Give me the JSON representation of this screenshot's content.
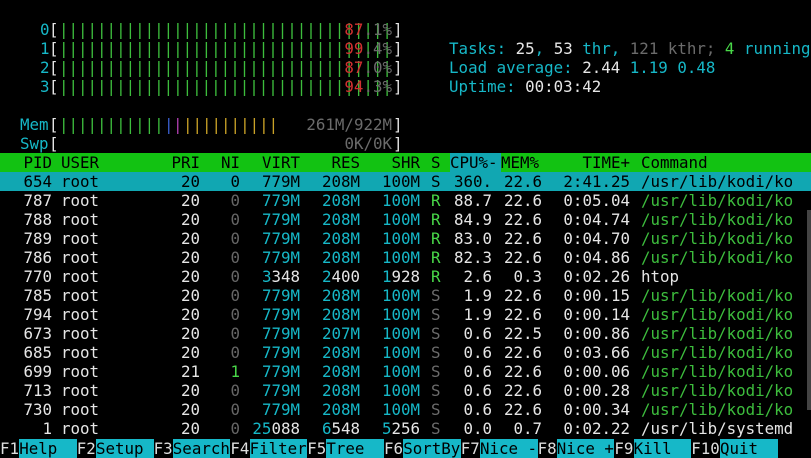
{
  "cpus": [
    {
      "label": "0",
      "bar": "|||||||||||||||||||||||||||||||||||",
      "percent": "87.1%"
    },
    {
      "label": "1",
      "bar": "|||||||||||||||||||||||||||||||||||",
      "percent": "99.4%"
    },
    {
      "label": "2",
      "bar": "|||||||||||||||||||||||||||||||||||",
      "percent": "87.0%"
    },
    {
      "label": "3",
      "bar": "|||||||||||||||||||||||||||||||||||",
      "percent": "94.3%"
    }
  ],
  "mem": {
    "label": "Mem",
    "bar_green": "|||||||||||",
    "bar_blue": "|",
    "bar_magenta": "|",
    "bar_yellow": "||||||||||",
    "value": "261M/922M"
  },
  "swp": {
    "label": "Swp",
    "value": "0K/0K"
  },
  "summary": {
    "tasks_label": "Tasks: ",
    "tasks": "25",
    "threads": "53",
    "thr_label": " thr, ",
    "kthr": "121",
    "kthr_label": " kthr; ",
    "running": "4",
    "running_label": " running",
    "load_label": "Load average: ",
    "load1": "2.44",
    "load5": "1.19",
    "load15": "0.48",
    "uptime_label": "Uptime: ",
    "uptime": "00:03:42"
  },
  "columns": [
    "PID",
    "USER",
    "PRI",
    "NI",
    "VIRT",
    "RES",
    "SHR",
    "S",
    "CPU%",
    "MEM%",
    "TIME+",
    "Command"
  ],
  "columns_display": {
    "pid": "PID",
    "user": "USER",
    "pri": "PRI",
    "ni": "NI",
    "virt": "VIRT",
    "res": "RES",
    "shr": "SHR",
    "s": "S",
    "cpu": "CPU%-",
    "mem": "MEM%",
    "time": "TIME+",
    "cmd": "Command"
  },
  "processes": [
    {
      "pid": "654",
      "user": "root",
      "pri": "20",
      "ni": "0",
      "virt": "779M",
      "res": "208M",
      "shr": "100M",
      "s": "S",
      "cpu": "360.",
      "mem": "22.6",
      "time": "2:41.25",
      "cmd": "/usr/lib/kodi/ko"
    },
    {
      "pid": "787",
      "user": "root",
      "pri": "20",
      "ni": "0",
      "virt": "779M",
      "res": "208M",
      "shr": "100M",
      "s": "R",
      "cpu": "88.7",
      "mem": "22.6",
      "time": "0:05.04",
      "cmd": "/usr/lib/kodi/ko"
    },
    {
      "pid": "788",
      "user": "root",
      "pri": "20",
      "ni": "0",
      "virt": "779M",
      "res": "208M",
      "shr": "100M",
      "s": "R",
      "cpu": "84.9",
      "mem": "22.6",
      "time": "0:04.74",
      "cmd": "/usr/lib/kodi/ko"
    },
    {
      "pid": "789",
      "user": "root",
      "pri": "20",
      "ni": "0",
      "virt": "779M",
      "res": "208M",
      "shr": "100M",
      "s": "R",
      "cpu": "83.0",
      "mem": "22.6",
      "time": "0:04.70",
      "cmd": "/usr/lib/kodi/ko"
    },
    {
      "pid": "786",
      "user": "root",
      "pri": "20",
      "ni": "0",
      "virt": "779M",
      "res": "208M",
      "shr": "100M",
      "s": "R",
      "cpu": "82.3",
      "mem": "22.6",
      "time": "0:04.86",
      "cmd": "/usr/lib/kodi/ko"
    },
    {
      "pid": "770",
      "user": "root",
      "pri": "20",
      "ni": "0",
      "virt": "3348",
      "res": "2400",
      "shr": "1928",
      "s": "R",
      "cpu": "2.6",
      "mem": "0.3",
      "time": "0:02.26",
      "cmd": "htop"
    },
    {
      "pid": "785",
      "user": "root",
      "pri": "20",
      "ni": "0",
      "virt": "779M",
      "res": "208M",
      "shr": "100M",
      "s": "S",
      "cpu": "1.9",
      "mem": "22.6",
      "time": "0:00.15",
      "cmd": "/usr/lib/kodi/ko"
    },
    {
      "pid": "794",
      "user": "root",
      "pri": "20",
      "ni": "0",
      "virt": "779M",
      "res": "208M",
      "shr": "100M",
      "s": "S",
      "cpu": "1.9",
      "mem": "22.6",
      "time": "0:00.14",
      "cmd": "/usr/lib/kodi/ko"
    },
    {
      "pid": "673",
      "user": "root",
      "pri": "20",
      "ni": "0",
      "virt": "779M",
      "res": "207M",
      "shr": "100M",
      "s": "S",
      "cpu": "0.6",
      "mem": "22.5",
      "time": "0:00.86",
      "cmd": "/usr/lib/kodi/ko"
    },
    {
      "pid": "685",
      "user": "root",
      "pri": "20",
      "ni": "0",
      "virt": "779M",
      "res": "208M",
      "shr": "100M",
      "s": "S",
      "cpu": "0.6",
      "mem": "22.6",
      "time": "0:03.66",
      "cmd": "/usr/lib/kodi/ko"
    },
    {
      "pid": "699",
      "user": "root",
      "pri": "21",
      "ni": "1",
      "virt": "779M",
      "res": "208M",
      "shr": "100M",
      "s": "S",
      "cpu": "0.6",
      "mem": "22.6",
      "time": "0:00.06",
      "cmd": "/usr/lib/kodi/ko"
    },
    {
      "pid": "713",
      "user": "root",
      "pri": "20",
      "ni": "0",
      "virt": "779M",
      "res": "208M",
      "shr": "100M",
      "s": "S",
      "cpu": "0.6",
      "mem": "22.6",
      "time": "0:00.28",
      "cmd": "/usr/lib/kodi/ko"
    },
    {
      "pid": "730",
      "user": "root",
      "pri": "20",
      "ni": "0",
      "virt": "779M",
      "res": "208M",
      "shr": "100M",
      "s": "S",
      "cpu": "0.6",
      "mem": "22.6",
      "time": "0:00.34",
      "cmd": "/usr/lib/kodi/ko"
    },
    {
      "pid": "1",
      "user": "root",
      "pri": "20",
      "ni": "0",
      "virt": "25088",
      "res": "6548",
      "shr": "5256",
      "s": "S",
      "cpu": "0.0",
      "mem": "0.7",
      "time": "0:02.22",
      "cmd": "/usr/lib/systemd"
    }
  ],
  "fkeys": [
    {
      "key": "F1",
      "label": "Help  "
    },
    {
      "key": "F2",
      "label": "Setup "
    },
    {
      "key": "F3",
      "label": "Search"
    },
    {
      "key": "F4",
      "label": "Filter"
    },
    {
      "key": "F5",
      "label": "Tree  "
    },
    {
      "key": "F6",
      "label": "SortBy"
    },
    {
      "key": "F7",
      "label": "Nice -"
    },
    {
      "key": "F8",
      "label": "Nice +"
    },
    {
      "key": "F9",
      "label": "Kill  "
    },
    {
      "key": "F10",
      "label": "Quit "
    }
  ],
  "colors": {
    "header_bg": "#12c212",
    "selected_bg": "#11a7b2",
    "fkey_bg": "#16b8c8"
  }
}
